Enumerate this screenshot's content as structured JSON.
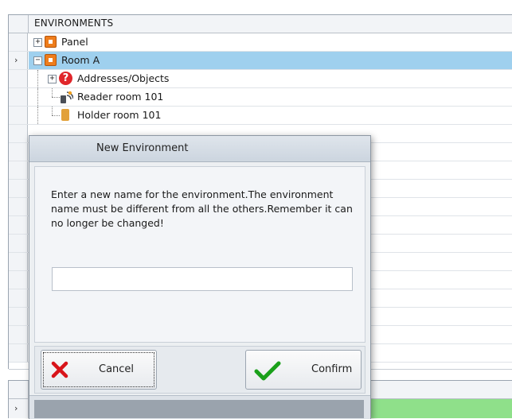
{
  "tree": {
    "column_header": "ENVIRONMENTS",
    "nodes": [
      {
        "label": "Panel",
        "icon": "environment-icon",
        "expander": "+"
      },
      {
        "label": "Room A",
        "icon": "environment-icon",
        "expander": "−",
        "selected": true
      },
      {
        "label": "Addresses/Objects",
        "icon": "question-icon",
        "expander": "+"
      },
      {
        "label": "Reader room 101",
        "icon": "reader-icon"
      },
      {
        "label": "Holder room 101",
        "icon": "holder-icon"
      }
    ],
    "row_indicator": "›"
  },
  "dialog": {
    "title": "New Environment",
    "message": "Enter a new name for the environment.The environment name must be different from all the others.Remember it can no longer be changed!",
    "name_input": {
      "value": "",
      "placeholder": ""
    },
    "cancel_label": "Cancel",
    "confirm_label": "Confirm"
  },
  "bottom_panel": {
    "row_indicator": "›",
    "highlight_color": "#8fe08a"
  },
  "colors": {
    "selected_row": "#9fd0ee",
    "environment_icon": "#ee7d1c",
    "question_icon": "#e0262b",
    "cancel_icon": "#d8141a",
    "confirm_icon": "#1aa01a"
  }
}
